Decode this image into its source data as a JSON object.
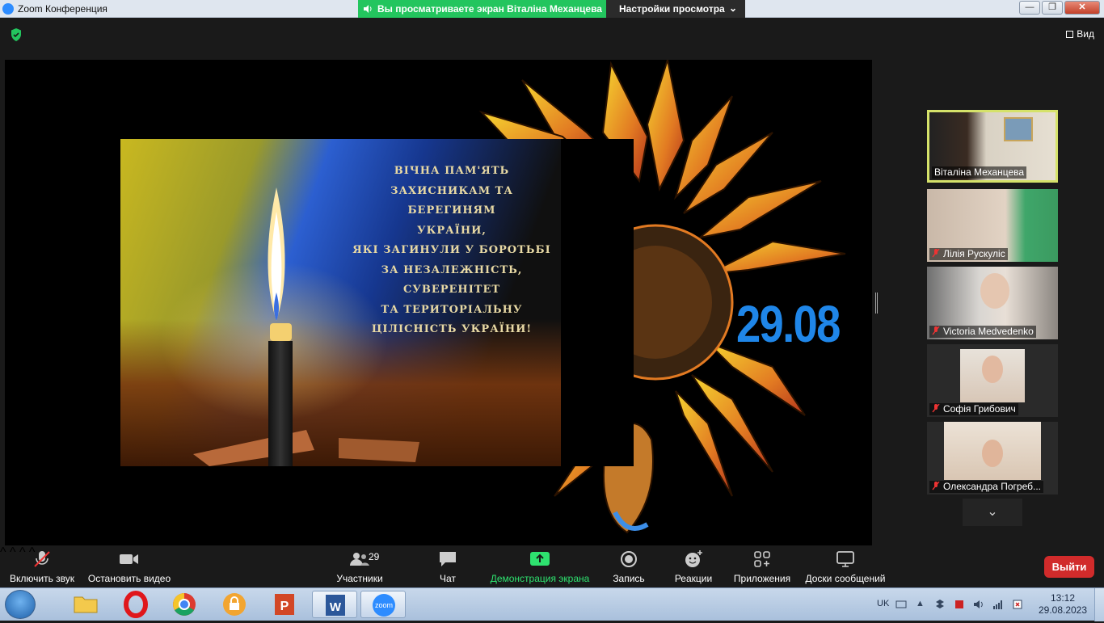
{
  "window": {
    "title": "Zoom Конференция"
  },
  "share_banner": {
    "text": "Вы просматриваете экран Віталіна Механцева",
    "view_settings": "Настройки просмотра"
  },
  "topbar": {
    "view_label": "Вид"
  },
  "slide": {
    "lines": [
      "ВІЧНА ПАМ'ЯТЬ",
      "ЗАХИСНИКАМ ТА БЕРЕГИНЯМ",
      "УКРАЇНИ,",
      "ЯКІ ЗАГИНУЛИ У БОРОТЬБІ",
      "ЗА НЕЗАЛЕЖНІСТЬ,",
      "СУВЕРЕНІТЕТ",
      "ТА ТЕРИТОРІАЛЬНУ",
      "ЦІЛІСНІСТЬ УКРАЇНИ!"
    ],
    "date": "29.08"
  },
  "participants_gallery": [
    {
      "name": "Віталіна Механцева",
      "muted": false,
      "active": true
    },
    {
      "name": "Лілія Рускуліс",
      "muted": true,
      "active": false
    },
    {
      "name": "Victoria Medvedenko",
      "muted": true,
      "active": false
    },
    {
      "name": "Софія Грибович",
      "muted": true,
      "active": false
    },
    {
      "name": "Олександра Погреб...",
      "muted": true,
      "active": false
    }
  ],
  "toolbar": {
    "unmute": "Включить звук",
    "stop_video": "Остановить видео",
    "participants": "Участники",
    "participants_count": "29",
    "chat": "Чат",
    "share_screen": "Демонстрация экрана",
    "record": "Запись",
    "reactions": "Реакции",
    "apps": "Приложения",
    "whiteboards": "Доски сообщений",
    "leave": "Выйти"
  },
  "taskbar": {
    "apps": [
      "explorer",
      "opera",
      "chrome",
      "vpn",
      "powerpoint",
      "word",
      "zoom"
    ],
    "zoom_label": "zoom",
    "word_label": "W",
    "language": "UK",
    "time": "13:12",
    "date": "29.08.2023"
  },
  "colors": {
    "share_green": "#23c55e",
    "leave_red": "#d12b2b",
    "date_blue": "#1f86e8",
    "active_border": "#d5e26a"
  }
}
